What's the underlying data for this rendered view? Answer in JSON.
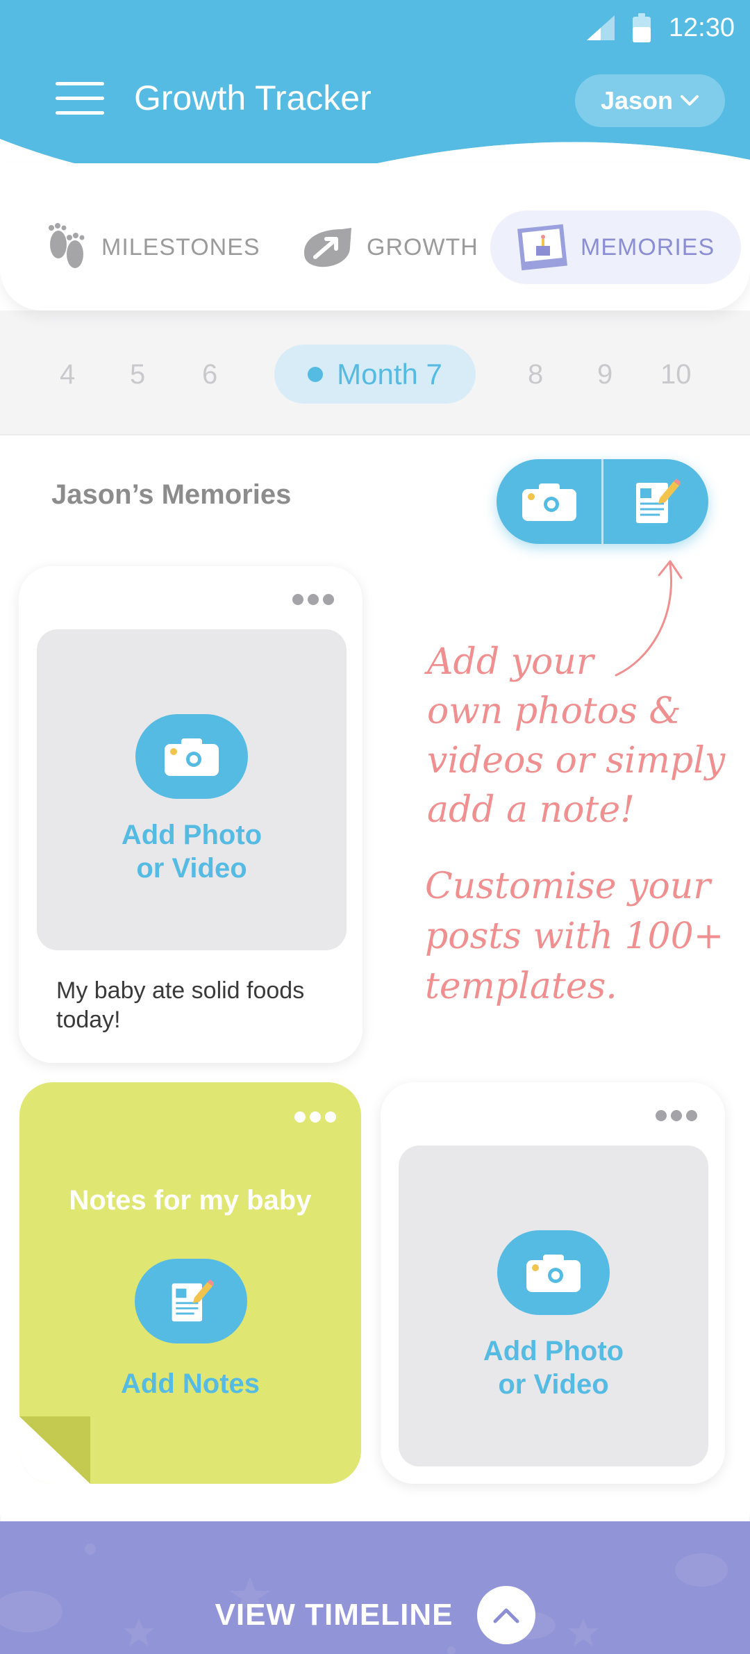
{
  "status": {
    "time": "12:30"
  },
  "header": {
    "title": "Growth Tracker",
    "user": "Jason"
  },
  "tabs": [
    {
      "label": "MILESTONES",
      "icon": "footprints-icon"
    },
    {
      "label": "GROWTH",
      "icon": "growth-arrow-icon"
    },
    {
      "label": "MEMORIES",
      "icon": "photo-frame-icon",
      "active": true
    }
  ],
  "months": {
    "before": [
      "4",
      "5",
      "6"
    ],
    "active": "Month 7",
    "after": [
      "8",
      "9",
      "10"
    ]
  },
  "memories": {
    "title": "Jason’s Memories",
    "card1": {
      "add_label_1": "Add Photo",
      "add_label_2": "or Video",
      "caption": "My baby ate solid foods today!"
    },
    "note_card": {
      "title": "Notes for my baby",
      "add_label": "Add Notes"
    },
    "card3": {
      "add_label_1": "Add Photo",
      "add_label_2": "or Video"
    }
  },
  "annotation": {
    "line1": [
      "Add your",
      "own photos &",
      "videos or simply",
      "add a note!"
    ],
    "line2": [
      "Customise your",
      "posts with 100+",
      "templates."
    ]
  },
  "footer": {
    "label": "VIEW TIMELINE"
  },
  "colors": {
    "primary": "#56bbe3",
    "accent": "#8b8ed3",
    "note": "#dfe671",
    "handwriting": "#f08f8f"
  }
}
